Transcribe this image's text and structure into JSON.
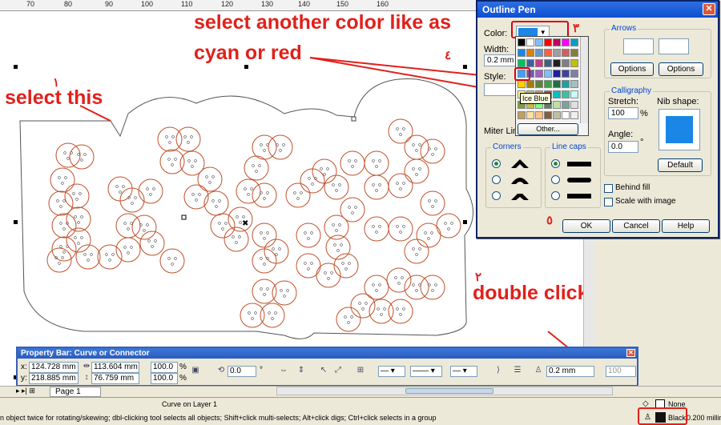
{
  "ruler": {
    "ticks": [
      "70",
      "80",
      "90",
      "100",
      "110",
      "120",
      "130",
      "140",
      "150",
      "160"
    ]
  },
  "annotations": {
    "step1_number": "١",
    "step1_text": "select this",
    "step2_number": "٢",
    "step2_text": "double click",
    "step3_number": "٣",
    "step3_text": "select another color like as",
    "step4_number": "٤",
    "step4_text": "cyan or red",
    "step5_number": "٥"
  },
  "dialog": {
    "title": "Outline Pen",
    "close_glyph": "✕",
    "color_label": "Color:",
    "width_label": "Width:",
    "width_value": "0.2 mm",
    "style_label": "Style:",
    "miter_label": "Miter Limit",
    "palette_tooltip": "Ice Blue",
    "other_button": "Other...",
    "arrows_label": "Arrows",
    "options_left": "Options",
    "options_right": "Options",
    "calligraphy_label": "Calligraphy",
    "stretch_label": "Stretch:",
    "stretch_value": "100",
    "stretch_unit": "%",
    "angle_label": "Angle:",
    "angle_value": "0.0",
    "angle_unit": "°",
    "nib_label": "Nib shape:",
    "default_button": "Default",
    "corners_label": "Corners",
    "linecaps_label": "Line caps",
    "behind_fill_label": "Behind fill",
    "scale_image_label": "Scale with image",
    "ok_button": "OK",
    "cancel_button": "Cancel",
    "help_button": "Help",
    "selected_color": "#1a86e6"
  },
  "palette_colors": [
    "#000000",
    "#fff",
    "#7fbfff",
    "#ff0000",
    "#c00060",
    "#ff00ff",
    "#00a0c0",
    "#1a86e6",
    "#e08000",
    "#6699cc",
    "#ff6040",
    "#a0a0a0",
    "#d06060",
    "#808040",
    "#00c060",
    "#4060a0",
    "#c04080",
    "#406080",
    "#202020",
    "#808080",
    "#c0c000",
    "#40a0ff",
    "#6060c0",
    "#a060c0",
    "#80c0ff",
    "#2020a0",
    "#4040a0",
    "#8080a0",
    "#ffd000",
    "#a08000",
    "#608040",
    "#40a040",
    "#207040",
    "#20a0a0",
    "#a0c0c0",
    "#ffff80",
    "#c0c080",
    "#c0a080",
    "#a06040",
    "#00c0c0",
    "#40c0a0",
    "#c0ffff",
    "#80a040",
    "#c0c040",
    "#80ff80",
    "#608060",
    "#c0e0a0",
    "#80a0a0",
    "#e0e0e0",
    "#c0a060",
    "#ffe0a0",
    "#ffc080",
    "#806040",
    "#c0c0a0",
    "#ffffff",
    "#f0f0f0"
  ],
  "propbar": {
    "title": "Property Bar: Curve or Connector",
    "close_glyph": "✕",
    "x_label": "x:",
    "x_value": "124.728 mm",
    "y_label": "y:",
    "y_value": "218.885 mm",
    "w_value": "113.604 mm",
    "h_value": "76.759 mm",
    "scale_x": "100.0",
    "scale_y": "100.0",
    "pct": "%",
    "rotate_value": "0.0",
    "rotate_unit": "°",
    "outline_width": "0.2 mm",
    "last_value": "100"
  },
  "pagebar": {
    "page_tab": "Page 1"
  },
  "status": {
    "layer_info": "Curve on Layer 1",
    "hint": "n object twice for rotating/skewing; dbl-clicking tool selects all objects; Shift+click multi-selects; Alt+click digs; Ctrl+click selects in a group",
    "fill_label": "None",
    "outline_color_name": "Black",
    "outline_width": "0.200 millim"
  }
}
